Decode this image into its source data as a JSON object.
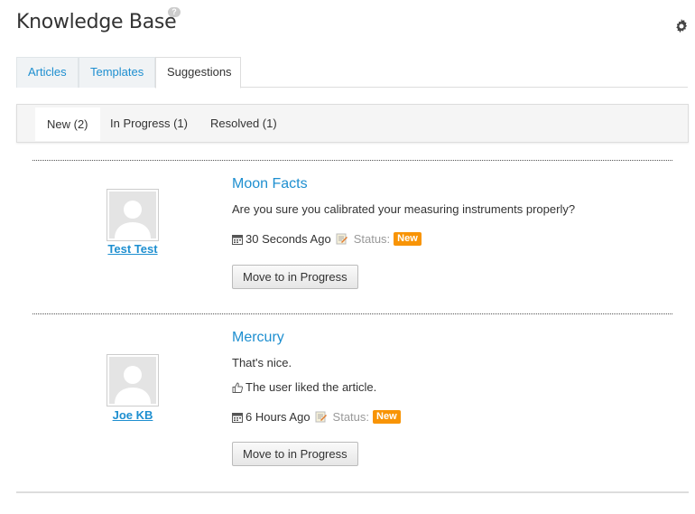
{
  "header": {
    "title": "Knowledge Base",
    "help_glyph": "?",
    "help_icon": "help-icon",
    "settings_icon": "gear-icon"
  },
  "tabs": [
    {
      "label": "Articles",
      "active": false
    },
    {
      "label": "Templates",
      "active": false
    },
    {
      "label": "Suggestions",
      "active": true
    }
  ],
  "subtabs": [
    {
      "label": "New (2)",
      "active": true
    },
    {
      "label": "In Progress (1)",
      "active": false
    },
    {
      "label": "Resolved (1)",
      "active": false
    }
  ],
  "suggestions": [
    {
      "user": "Test Test",
      "title": "Moon Facts",
      "message": "Are you sure you calibrated your measuring instruments properly?",
      "liked_text": "",
      "time": "30 Seconds Ago",
      "status_label": "Status:",
      "status": "New",
      "button": "Move to in Progress"
    },
    {
      "user": "Joe KB",
      "title": "Mercury",
      "message": "That's nice.",
      "liked_text": "The user liked the article.",
      "time": "6 Hours Ago",
      "status_label": "Status:",
      "status": "New",
      "button": "Move to in Progress"
    }
  ],
  "colors": {
    "link": "#1e8fd0",
    "badge": "#f89406"
  }
}
